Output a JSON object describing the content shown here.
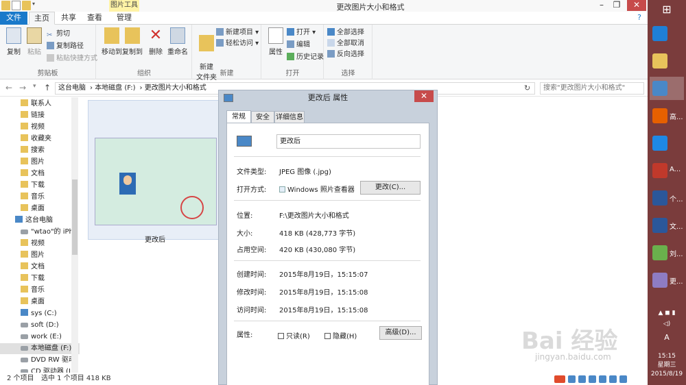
{
  "window": {
    "title": "更改图片大小和格式",
    "context_tab": "图片工具",
    "min": "–",
    "max": "❐",
    "close": "✕"
  },
  "tabs": [
    "文件",
    "主页",
    "共享",
    "查看",
    "管理"
  ],
  "ribbon": {
    "clipboard": {
      "copy": "复制",
      "paste": "粘贴",
      "cut": "剪切",
      "copy_path": "复制路径",
      "paste_shortcut": "粘贴快捷方式",
      "group": "剪贴板"
    },
    "organize": {
      "move_to": "移动到",
      "copy_to": "复制到",
      "delete": "删除",
      "rename": "重命名",
      "group": "组织"
    },
    "new": {
      "new_folder": "新建\n文件夹",
      "new_item": "新建项目 ▾",
      "easy_access": "轻松访问 ▾",
      "group": "新建"
    },
    "open": {
      "properties": "属性",
      "open": "打开 ▾",
      "edit": "编辑",
      "history": "历史记录",
      "group": "打开"
    },
    "select": {
      "select_all": "全部选择",
      "select_none": "全部取消",
      "invert": "反向选择",
      "group": "选择"
    }
  },
  "address": {
    "path": [
      "这台电脑",
      "本地磁盘 (F:)",
      "更改图片大小和格式"
    ],
    "search_placeholder": "搜索\"更改图片大小和格式\""
  },
  "nav": [
    "联系人",
    "链接",
    "视频",
    "收藏夹",
    "搜索",
    "图片",
    "文档",
    "下载",
    "音乐",
    "桌面",
    "这台电脑",
    "\"wtao\"的 iPho",
    "视频",
    "图片",
    "文档",
    "下载",
    "音乐",
    "桌面",
    "sys (C:)",
    "soft (D:)",
    "work (E:)",
    "本地磁盘 (F:)",
    "DVD RW 驱动",
    "CD 驱动器 (I:)"
  ],
  "file": {
    "name": "更改后"
  },
  "status": {
    "count": "2 个项目",
    "selected": "选中 1 个项目  418 KB"
  },
  "dialog": {
    "title": "更改后 属性",
    "tabs": [
      "常规",
      "安全",
      "详细信息"
    ],
    "name": "更改后",
    "file_type_label": "文件类型:",
    "file_type": "JPEG 图像 (.jpg)",
    "open_with_label": "打开方式:",
    "open_with": "Windows 照片查看器",
    "change_btn": "更改(C)...",
    "location_label": "位置:",
    "location": "F:\\更改图片大小和格式",
    "size_label": "大小:",
    "size": "418 KB (428,773 字节)",
    "disk_label": "占用空间:",
    "disk": "420 KB (430,080 字节)",
    "created_label": "创建时间:",
    "created": "2015年8月19日，15:15:07",
    "modified_label": "修改时间:",
    "modified": "2015年8月19日，15:15:08",
    "accessed_label": "访问时间:",
    "accessed": "2015年8月19日，15:15:08",
    "attr_label": "属性:",
    "readonly": "只读(R)",
    "hidden": "隐藏(H)",
    "advanced_btn": "高级(D)..."
  },
  "taskbar": {
    "items": [
      "",
      "",
      "",
      "",
      "高...",
      "",
      "A...",
      "个...",
      "文...",
      "刘...",
      "更..."
    ],
    "time": "15:15",
    "weekday": "星期三",
    "date": "2015/8/19",
    "ime": "A"
  },
  "watermark": {
    "text": "Bai 经验",
    "url": "jingyan.baidu.com"
  }
}
